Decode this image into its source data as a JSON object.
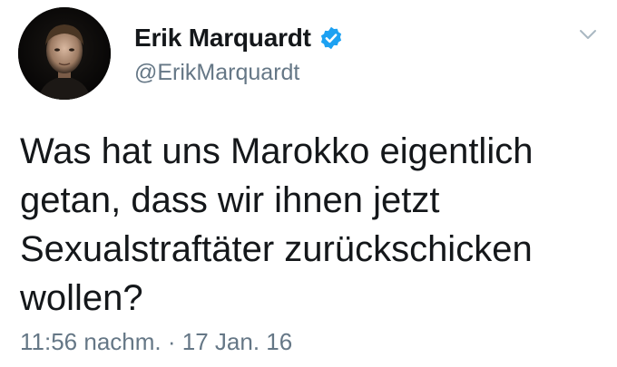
{
  "author": {
    "display_name": "Erik Marquardt",
    "handle": "@ErikMarquardt",
    "verified": true,
    "verified_color": "#1da1f2"
  },
  "tweet": {
    "text": "Was hat uns Marokko eigentlich\ngetan, dass wir ihnen jetzt\nSexualstraftäter zurückschicken\nwollen?",
    "time": "11:56 nachm.",
    "separator": "·",
    "date": "17 Jan. 16"
  },
  "icons": {
    "verified": "verified-badge-icon",
    "menu": "chevron-down-icon"
  },
  "colors": {
    "text": "#14171a",
    "secondary": "#657786",
    "accent": "#1da1f2"
  }
}
